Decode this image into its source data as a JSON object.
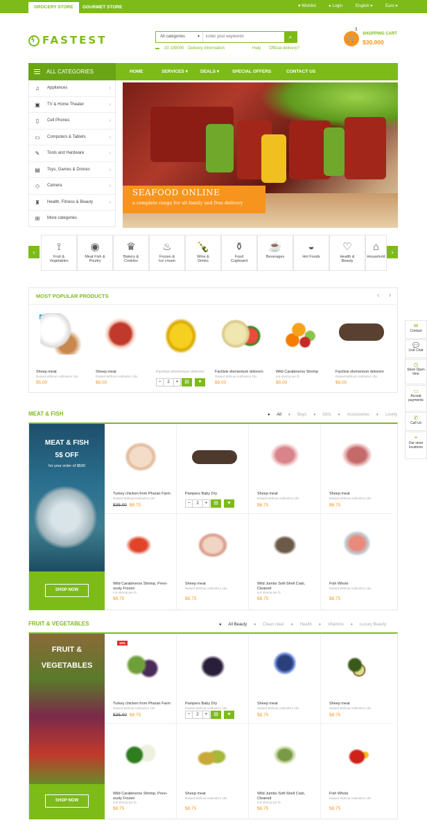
{
  "topbar": {
    "tab1": "GROCERY STORE",
    "tab2": "GOURMET STORE",
    "wishlist": "Wishlist",
    "login": "Login",
    "lang": "English",
    "currency": "Euro"
  },
  "header": {
    "logo": "FASTEST",
    "search_cat": "All categories",
    "search_placeholder": "Enter your keywords",
    "phone": "33 199000",
    "delivery": "Delivery information",
    "help": "Help",
    "official": "Official delivery?",
    "cart_label": "SHOPPING CART",
    "cart_total": "$30,000",
    "cart_count": "3"
  },
  "nav": {
    "allcat": "ALL CATEGORIES",
    "items": [
      "HOME",
      "SERVICES",
      "DEALS",
      "SPECIAL OFFERS",
      "CONTACT US"
    ]
  },
  "sidemenu": [
    "Appliances",
    "TV & Home Theater",
    "Cell Phones",
    "Computers & Tablets",
    "Tools and Hardware",
    "Toys, Games & Drones",
    "Camera",
    "Health, Fitness & Beauty",
    "More categories"
  ],
  "banner": {
    "title": "SEAFOOD ONLINE",
    "subtitle": "a complete range for all family and free delivery"
  },
  "categories": [
    {
      "l1": "Fruit &",
      "l2": "Vegetables"
    },
    {
      "l1": "Meat Fish &",
      "l2": "Poultry"
    },
    {
      "l1": "Bakery &",
      "l2": "Cookies"
    },
    {
      "l1": "Frozen &",
      "l2": "Ice cream"
    },
    {
      "l1": "Wine &",
      "l2": "Drinks"
    },
    {
      "l1": "Food",
      "l2": "Cupboard"
    },
    {
      "l1": "Beverages",
      "l2": ""
    },
    {
      "l1": "Hot Foods",
      "l2": ""
    },
    {
      "l1": "Health &",
      "l2": "Beauty"
    },
    {
      "l1": "Household",
      "l2": ""
    }
  ],
  "popular": {
    "title": "MOST POPULAR PRODUCTS",
    "new_badge": "NEW",
    "items": [
      {
        "name": "Sheep meat",
        "sub": "Raised Without Antibiotics 1bs",
        "price": "$5.00"
      },
      {
        "name": "Sheep meat",
        "sub": "Raised Without Antibiotics 1bs",
        "price": "$8.00"
      },
      {
        "name": "Facilisis elementum dolorem",
        "sub": "",
        "price": "",
        "qty": "2"
      },
      {
        "name": "Facilisis elementum dolorem",
        "sub": "Raised Without Antibiotics 1bs",
        "price": "$8.00"
      },
      {
        "name": "Wild Carabineros Shrimp",
        "sub": "6-8 shrimp per lb",
        "price": "$9.00"
      },
      {
        "name": "Facilisis elementum dolorem",
        "sub": "Raised Without Antibiotics 1bs",
        "price": "$8.00"
      }
    ]
  },
  "meat": {
    "title": "MEAT & FISH",
    "filters": [
      "All",
      "Boys",
      "Girls",
      "Accessories",
      "Lovely"
    ],
    "promo": {
      "title": "MEAT & FISH",
      "offer": "5$ OFF",
      "sub": "for your order of $500",
      "button": "SHOP NOW"
    },
    "items": [
      {
        "name": "Turkey chicken from Pharan Farm",
        "sub": "Raised Without Antibiotics 1bs",
        "old": "$35.00",
        "price": "$8.75"
      },
      {
        "name": "Pampers Baby Dry",
        "sub": "",
        "old": "",
        "price": "",
        "qty": "2"
      },
      {
        "name": "Sheep meat",
        "sub": "Raised Without Antibiotics 1bs",
        "old": "",
        "price": "$8.75"
      },
      {
        "name": "Sheep meat",
        "sub": "Raised Without Antibiotics 1bs",
        "old": "",
        "price": "$8.75"
      },
      {
        "name": "Wild Carabineros Shrimp, Previ-ously Frozen",
        "sub": "6-8 shrimp per lb",
        "old": "",
        "price": "$8.75"
      },
      {
        "name": "Sheep meat",
        "sub": "Raised Without Antibiotics 1bs",
        "old": "",
        "price": "$8.75"
      },
      {
        "name": "Wild Jumbo Soft-Shell Crab, Cleaned",
        "sub": "6-8 shrimp per lb",
        "old": "",
        "price": "$8.75"
      },
      {
        "name": "Fish Whole",
        "sub": "Raised Without Antibiotics 1bs",
        "old": "",
        "price": "$8.75"
      }
    ]
  },
  "fruit": {
    "title": "FRUIT & VEGETABLES",
    "filters": [
      "All Beauty",
      "Clean clear",
      "Health",
      "Vitamins",
      "Luxury Beauty"
    ],
    "promo": {
      "title": "FRUIT &",
      "title2": "VEGETABLES",
      "button": "SHOP NOW"
    },
    "sale_badge": "15%",
    "items": [
      {
        "name": "Turkey chicken from Pharan Farm",
        "sub": "Raised Without Antibiotics 1bs",
        "old": "$35.00",
        "price": "$8.75"
      },
      {
        "name": "Pampers Baby Dry",
        "sub": "Raised Without Antibiotics 1bs",
        "old": "",
        "price": "",
        "qty": "2"
      },
      {
        "name": "Sheep meat",
        "sub": "Raised Without Antibiotics 1bs",
        "old": "",
        "price": "$8.75"
      },
      {
        "name": "Sheep meat",
        "sub": "Raised Without Antibiotics 1bs",
        "old": "",
        "price": "$8.75"
      },
      {
        "name": "Wild Carabineros Shrimp, Previ-ously Frozen",
        "sub": "6-8 shrimp per lb",
        "old": "",
        "price": "$8.75"
      },
      {
        "name": "Sheep meat",
        "sub": "Raised Without Antibiotics 1bs",
        "old": "",
        "price": "$8.75"
      },
      {
        "name": "Wild Jumbo Soft-Shell Crab, Cleaned",
        "sub": "6-8 shrimp per lb",
        "old": "",
        "price": "$8.75"
      },
      {
        "name": "Fish Whole",
        "sub": "Raised Without Antibiotics 1bs",
        "old": "",
        "price": "$8.75"
      }
    ]
  },
  "sidefloat": [
    "Contact",
    "Live Chat",
    "Store Open time",
    "Accept payments",
    "Call Us",
    "Our store locations"
  ],
  "colors": {
    "accent": "#7dbb19",
    "orange": "#f7941d"
  }
}
